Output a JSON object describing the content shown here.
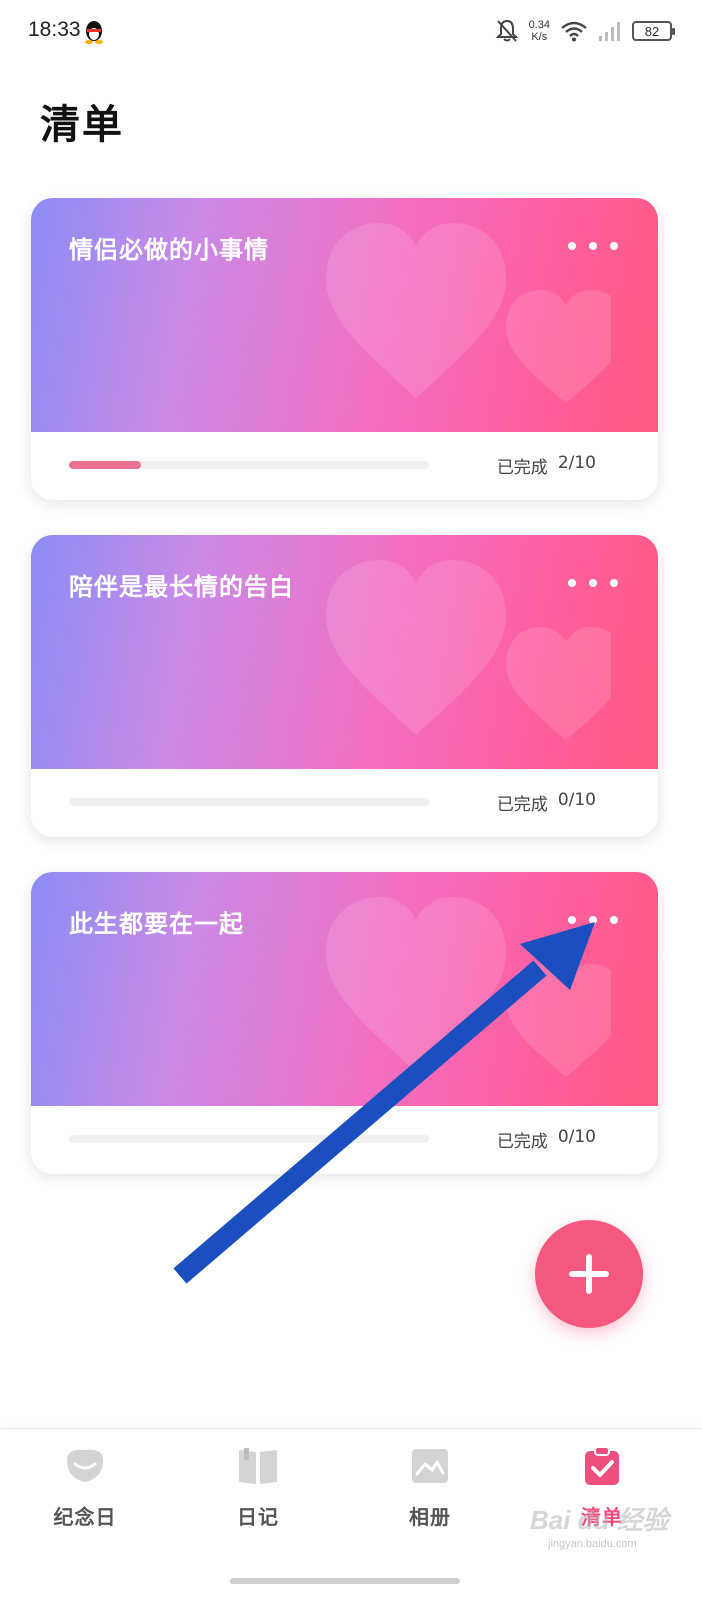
{
  "status_bar": {
    "time": "18:33",
    "net_speed_value": "0.34",
    "net_speed_unit": "K/s",
    "battery": "82"
  },
  "header": {
    "title": "清单"
  },
  "lists": [
    {
      "title": "情侣必做的小事情",
      "completed_label": "已完成",
      "count": "2/10",
      "progress": 0.2
    },
    {
      "title": "陪伴是最长情的告白",
      "completed_label": "已完成",
      "count": "0/10",
      "progress": 0
    },
    {
      "title": "此生都要在一起",
      "completed_label": "已完成",
      "count": "0/10",
      "progress": 0
    }
  ],
  "bottom_nav": [
    {
      "label": "纪念日",
      "icon": "anniversary-icon",
      "active": false
    },
    {
      "label": "日记",
      "icon": "diary-book-icon",
      "active": false
    },
    {
      "label": "相册",
      "icon": "album-icon",
      "active": false
    },
    {
      "label": "清单",
      "icon": "checklist-icon",
      "active": true
    }
  ],
  "watermark": {
    "text": "Bai du 经验",
    "subtext": "jingyan.baidu.com"
  },
  "colors": {
    "accent": "#f4587e",
    "active_nav": "#ef4f7c",
    "progress_fill": "#ec6f94",
    "annotation_arrow": "#1b4fbf"
  }
}
